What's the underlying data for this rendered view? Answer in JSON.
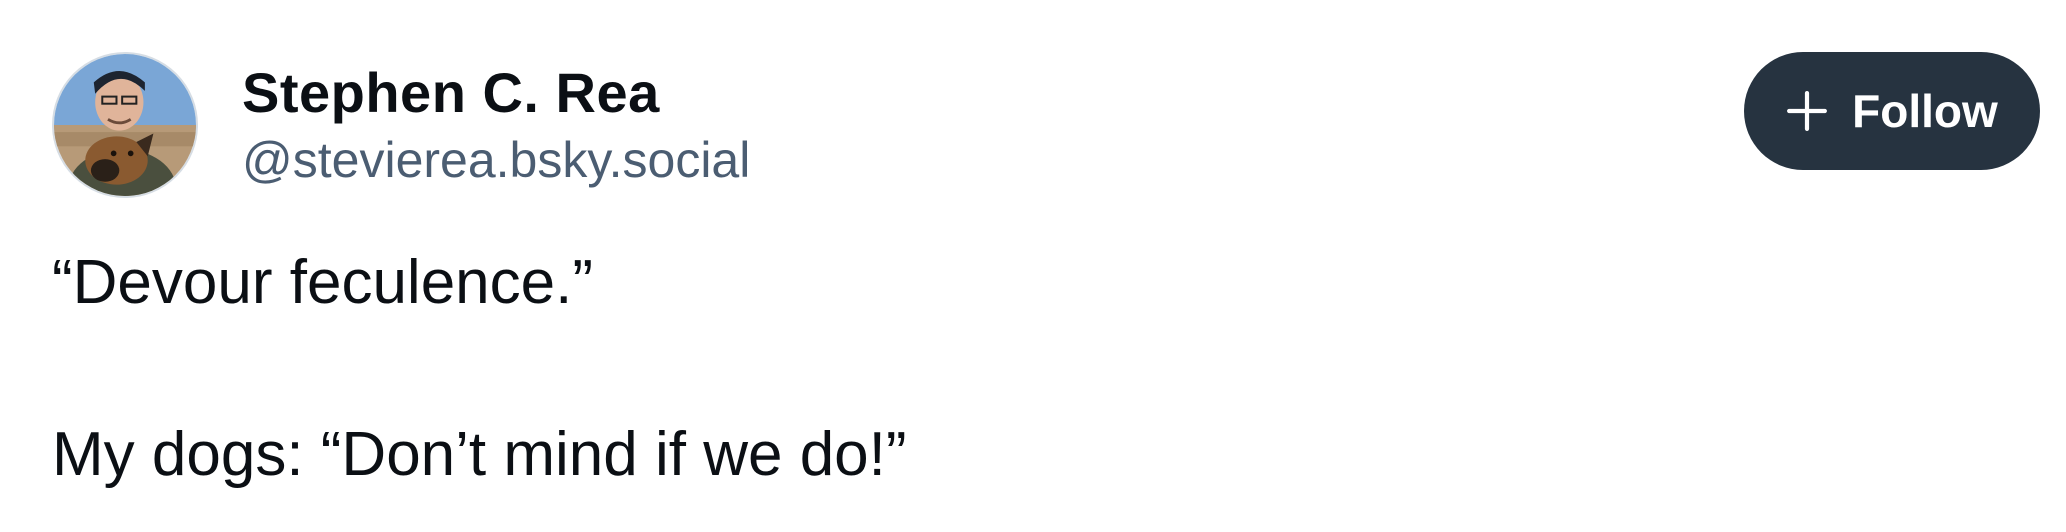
{
  "post": {
    "author": {
      "display_name": "Stephen C. Rea",
      "handle": "@stevierea.bsky.social",
      "avatar_icon": "avatar-photo-man-with-dog"
    },
    "follow_button": {
      "label": "Follow",
      "icon": "plus-icon"
    },
    "text_lines": [
      "“Devour feculence.”",
      "",
      "My dogs: “Don’t mind if we do!”"
    ]
  },
  "colors": {
    "background": "#ffffff",
    "text": "#0b0f14",
    "handle": "#4b5d72",
    "follow_button_bg": "#263340",
    "follow_button_text": "#ffffff"
  }
}
